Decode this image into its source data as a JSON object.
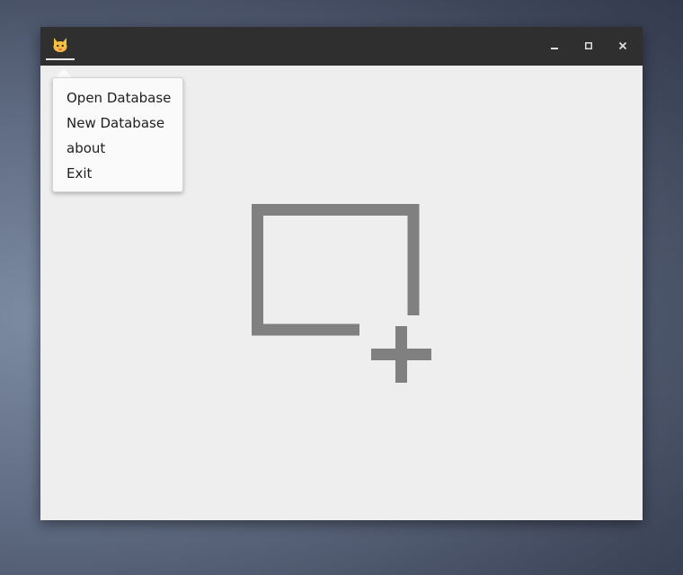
{
  "window": {
    "icon": "cat-icon",
    "controls": {
      "minimize_icon": "minimize-icon",
      "maximize_icon": "maximize-icon",
      "close_icon": "close-icon"
    }
  },
  "app_menu": {
    "items": [
      {
        "label": "Open Database"
      },
      {
        "label": "New Database"
      },
      {
        "label": "about"
      },
      {
        "label": "Exit"
      }
    ]
  },
  "content": {
    "graphic_icon": "new-database-icon"
  },
  "colors": {
    "titlebar": "#2f2f2f",
    "content_background": "#eeeeee",
    "graphic": "#808080",
    "menu_background": "#fafafa",
    "menu_text": "#1f1f1f",
    "cat_icon": "#f5c13f"
  }
}
